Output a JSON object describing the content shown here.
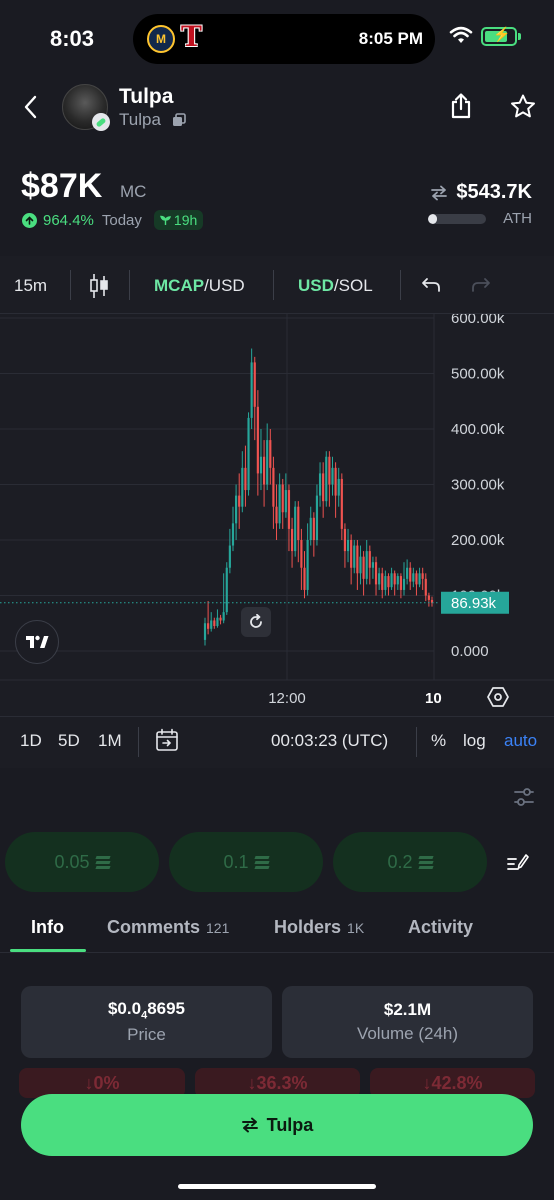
{
  "status_bar": {
    "time": "8:03",
    "island_time": "8:05 PM"
  },
  "token": {
    "name": "Tulpa",
    "ticker": "Tulpa"
  },
  "market": {
    "mc_value": "$87K",
    "mc_label": "MC",
    "change_pct": "964.4%",
    "change_label": "Today",
    "age": "19h",
    "ath_value": "$543.7K",
    "ath_label": "ATH",
    "ath_progress": 0.16
  },
  "chart_toolbar": {
    "interval": "15m",
    "mcap_label": "MCAP",
    "mcap_suffix": "/USD",
    "usd_label": "USD",
    "usd_suffix": "/SOL"
  },
  "chart_data": {
    "type": "candlestick",
    "y_ticks": [
      "600.00k",
      "500.00k",
      "400.00k",
      "300.00k",
      "200.00k",
      "100.00k",
      "0.000"
    ],
    "ylim": [
      0,
      600
    ],
    "x_ticks": [
      "12:00",
      "10"
    ],
    "current_value": "86.93k",
    "colors": {
      "up": "#26a69a",
      "down": "#ef5350",
      "price_line": "#26a69a"
    },
    "candles_k": [
      [
        20,
        50,
        10,
        60
      ],
      [
        50,
        40,
        30,
        90
      ],
      [
        40,
        55,
        35,
        70
      ],
      [
        55,
        45,
        40,
        60
      ],
      [
        45,
        60,
        42,
        75
      ],
      [
        60,
        55,
        48,
        65
      ],
      [
        55,
        70,
        50,
        140
      ],
      [
        70,
        150,
        65,
        160
      ],
      [
        150,
        190,
        140,
        220
      ],
      [
        190,
        230,
        180,
        260
      ],
      [
        230,
        280,
        200,
        300
      ],
      [
        280,
        260,
        220,
        320
      ],
      [
        260,
        330,
        250,
        360
      ],
      [
        330,
        290,
        260,
        370
      ],
      [
        290,
        420,
        280,
        430
      ],
      [
        420,
        520,
        400,
        545
      ],
      [
        520,
        440,
        380,
        530
      ],
      [
        440,
        320,
        280,
        470
      ],
      [
        320,
        350,
        290,
        400
      ],
      [
        350,
        300,
        260,
        380
      ],
      [
        300,
        380,
        290,
        410
      ],
      [
        380,
        330,
        300,
        400
      ],
      [
        330,
        260,
        220,
        350
      ],
      [
        260,
        230,
        200,
        300
      ],
      [
        230,
        300,
        220,
        320
      ],
      [
        300,
        250,
        220,
        310
      ],
      [
        250,
        290,
        240,
        320
      ],
      [
        290,
        220,
        180,
        300
      ],
      [
        220,
        180,
        150,
        240
      ],
      [
        180,
        260,
        170,
        270
      ],
      [
        260,
        200,
        160,
        270
      ],
      [
        200,
        150,
        110,
        220
      ],
      [
        150,
        110,
        95,
        180
      ],
      [
        110,
        200,
        100,
        230
      ],
      [
        200,
        240,
        190,
        260
      ],
      [
        240,
        200,
        170,
        250
      ],
      [
        200,
        280,
        190,
        300
      ],
      [
        280,
        320,
        260,
        340
      ],
      [
        320,
        270,
        240,
        340
      ],
      [
        270,
        350,
        260,
        360
      ],
      [
        350,
        300,
        260,
        360
      ],
      [
        300,
        330,
        280,
        350
      ],
      [
        330,
        280,
        240,
        340
      ],
      [
        280,
        310,
        260,
        330
      ],
      [
        310,
        220,
        200,
        320
      ],
      [
        220,
        180,
        150,
        230
      ],
      [
        180,
        200,
        160,
        220
      ],
      [
        200,
        150,
        120,
        210
      ],
      [
        150,
        190,
        140,
        200
      ],
      [
        190,
        140,
        110,
        200
      ],
      [
        140,
        170,
        120,
        190
      ],
      [
        170,
        130,
        100,
        180
      ],
      [
        130,
        180,
        120,
        200
      ],
      [
        180,
        150,
        120,
        190
      ],
      [
        150,
        160,
        130,
        170
      ],
      [
        160,
        120,
        100,
        170
      ],
      [
        120,
        140,
        110,
        150
      ],
      [
        140,
        110,
        95,
        150
      ],
      [
        110,
        135,
        100,
        145
      ],
      [
        135,
        115,
        100,
        140
      ],
      [
        115,
        140,
        110,
        150
      ],
      [
        140,
        120,
        100,
        145
      ],
      [
        120,
        135,
        110,
        140
      ],
      [
        135,
        110,
        95,
        140
      ],
      [
        110,
        130,
        100,
        160
      ],
      [
        130,
        150,
        120,
        165
      ],
      [
        150,
        125,
        110,
        160
      ],
      [
        125,
        140,
        115,
        150
      ],
      [
        140,
        120,
        100,
        145
      ],
      [
        120,
        140,
        115,
        150
      ],
      [
        140,
        130,
        110,
        150
      ],
      [
        130,
        100,
        90,
        140
      ],
      [
        100,
        92,
        80,
        105
      ],
      [
        92,
        87,
        80,
        98
      ]
    ]
  },
  "timeframes": {
    "d1": "1D",
    "d5": "5D",
    "m1": "1M",
    "clock": "00:03:23 (UTC)",
    "percent": "%",
    "log": "log",
    "auto": "auto"
  },
  "quick_buy": [
    {
      "amount": "0.05"
    },
    {
      "amount": "0.1"
    },
    {
      "amount": "0.2"
    }
  ],
  "tabs": {
    "info": "Info",
    "comments": "Comments",
    "comments_count": "121",
    "holders": "Holders",
    "holders_count": "1K",
    "activity": "Activity"
  },
  "stats": {
    "price_prefix": "$0.0",
    "price_sub": "4",
    "price_rest": "8695",
    "price_label": "Price",
    "volume": "$2.1M",
    "volume_label": "Volume (24h)"
  },
  "changes": [
    "↓0%",
    "↓36.3%",
    "↓42.8%"
  ],
  "trade": {
    "label": "Tulpa"
  }
}
